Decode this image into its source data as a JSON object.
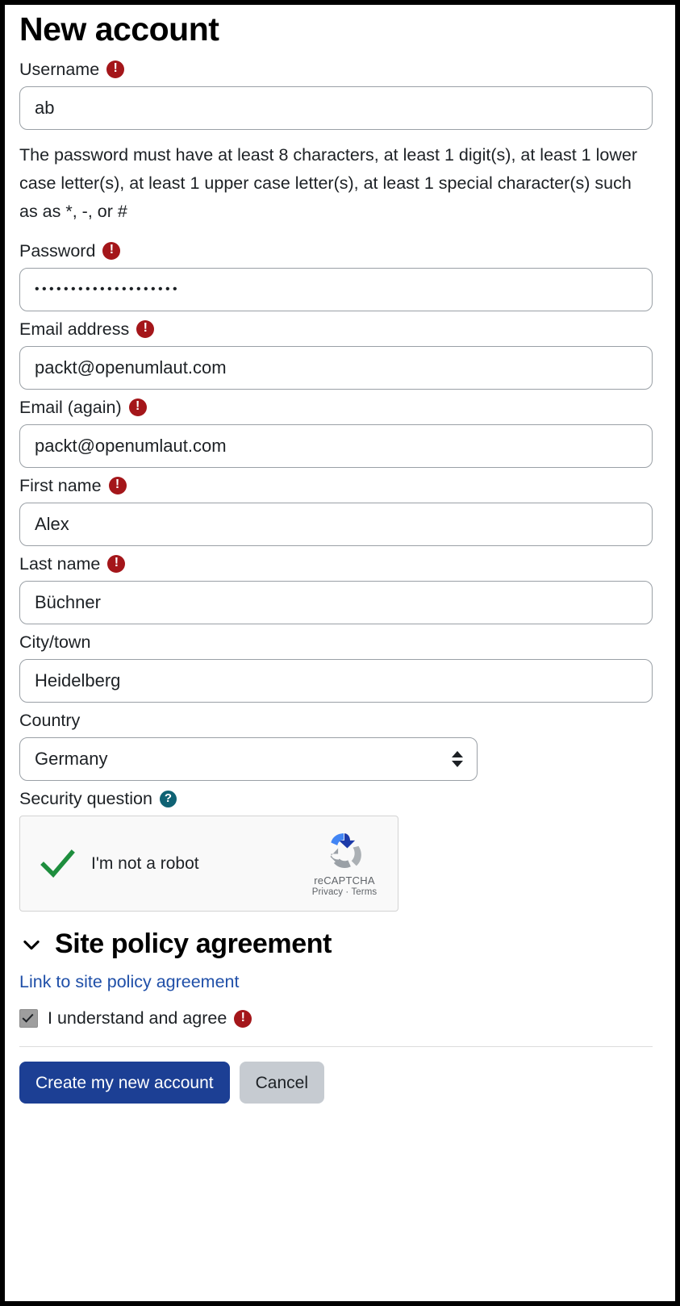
{
  "page": {
    "title": "New account"
  },
  "icons": {
    "required": "required-alert-icon",
    "help": "help-circle-icon",
    "chevron": "chevron-down-icon",
    "recaptcha": "recaptcha-logo-icon",
    "checkmark": "green-check-icon"
  },
  "colors": {
    "required_red": "#a4161a",
    "help_teal": "#0f6274",
    "link_blue": "#1f4fa8",
    "primary_button": "#1c3f94",
    "secondary_button": "#c6cbd1",
    "check_green": "#1e8e3e",
    "recaptcha_bg": "#f9f9f9"
  },
  "fields": {
    "username": {
      "label": "Username",
      "value": "ab",
      "placeholder": "",
      "required": true
    },
    "password_help": "The password must have at least 8 characters, at least 1 digit(s), at least 1 lower case letter(s), at least 1 upper case letter(s), at least 1 special character(s) such as as *, -, or #",
    "password": {
      "label": "Password",
      "value": "••••••••••••••••••••",
      "masked_char_count": 20,
      "required": true
    },
    "email": {
      "label": "Email address",
      "value": "packt@openumlaut.com",
      "required": true
    },
    "email_again": {
      "label": "Email (again)",
      "value": "packt@openumlaut.com",
      "required": true
    },
    "first_name": {
      "label": "First name",
      "value": "Alex",
      "required": true
    },
    "last_name": {
      "label": "Last name",
      "value": "Büchner",
      "required": true
    },
    "city": {
      "label": "City/town",
      "value": "Heidelberg",
      "required": false
    },
    "country": {
      "label": "Country",
      "value": "Germany",
      "required": false
    }
  },
  "security": {
    "label": "Security question",
    "has_help": true,
    "recaptcha": {
      "checkbox_label": "I'm not a robot",
      "checked": true,
      "brand": "reCAPTCHA",
      "legal": "Privacy · Terms"
    }
  },
  "site_policy": {
    "heading": "Site policy agreement",
    "expanded": true,
    "link_text": "Link to site policy agreement",
    "agree_label": "I understand and agree",
    "agree_checked": true,
    "agree_required": true
  },
  "actions": {
    "submit": "Create my new account",
    "cancel": "Cancel"
  }
}
